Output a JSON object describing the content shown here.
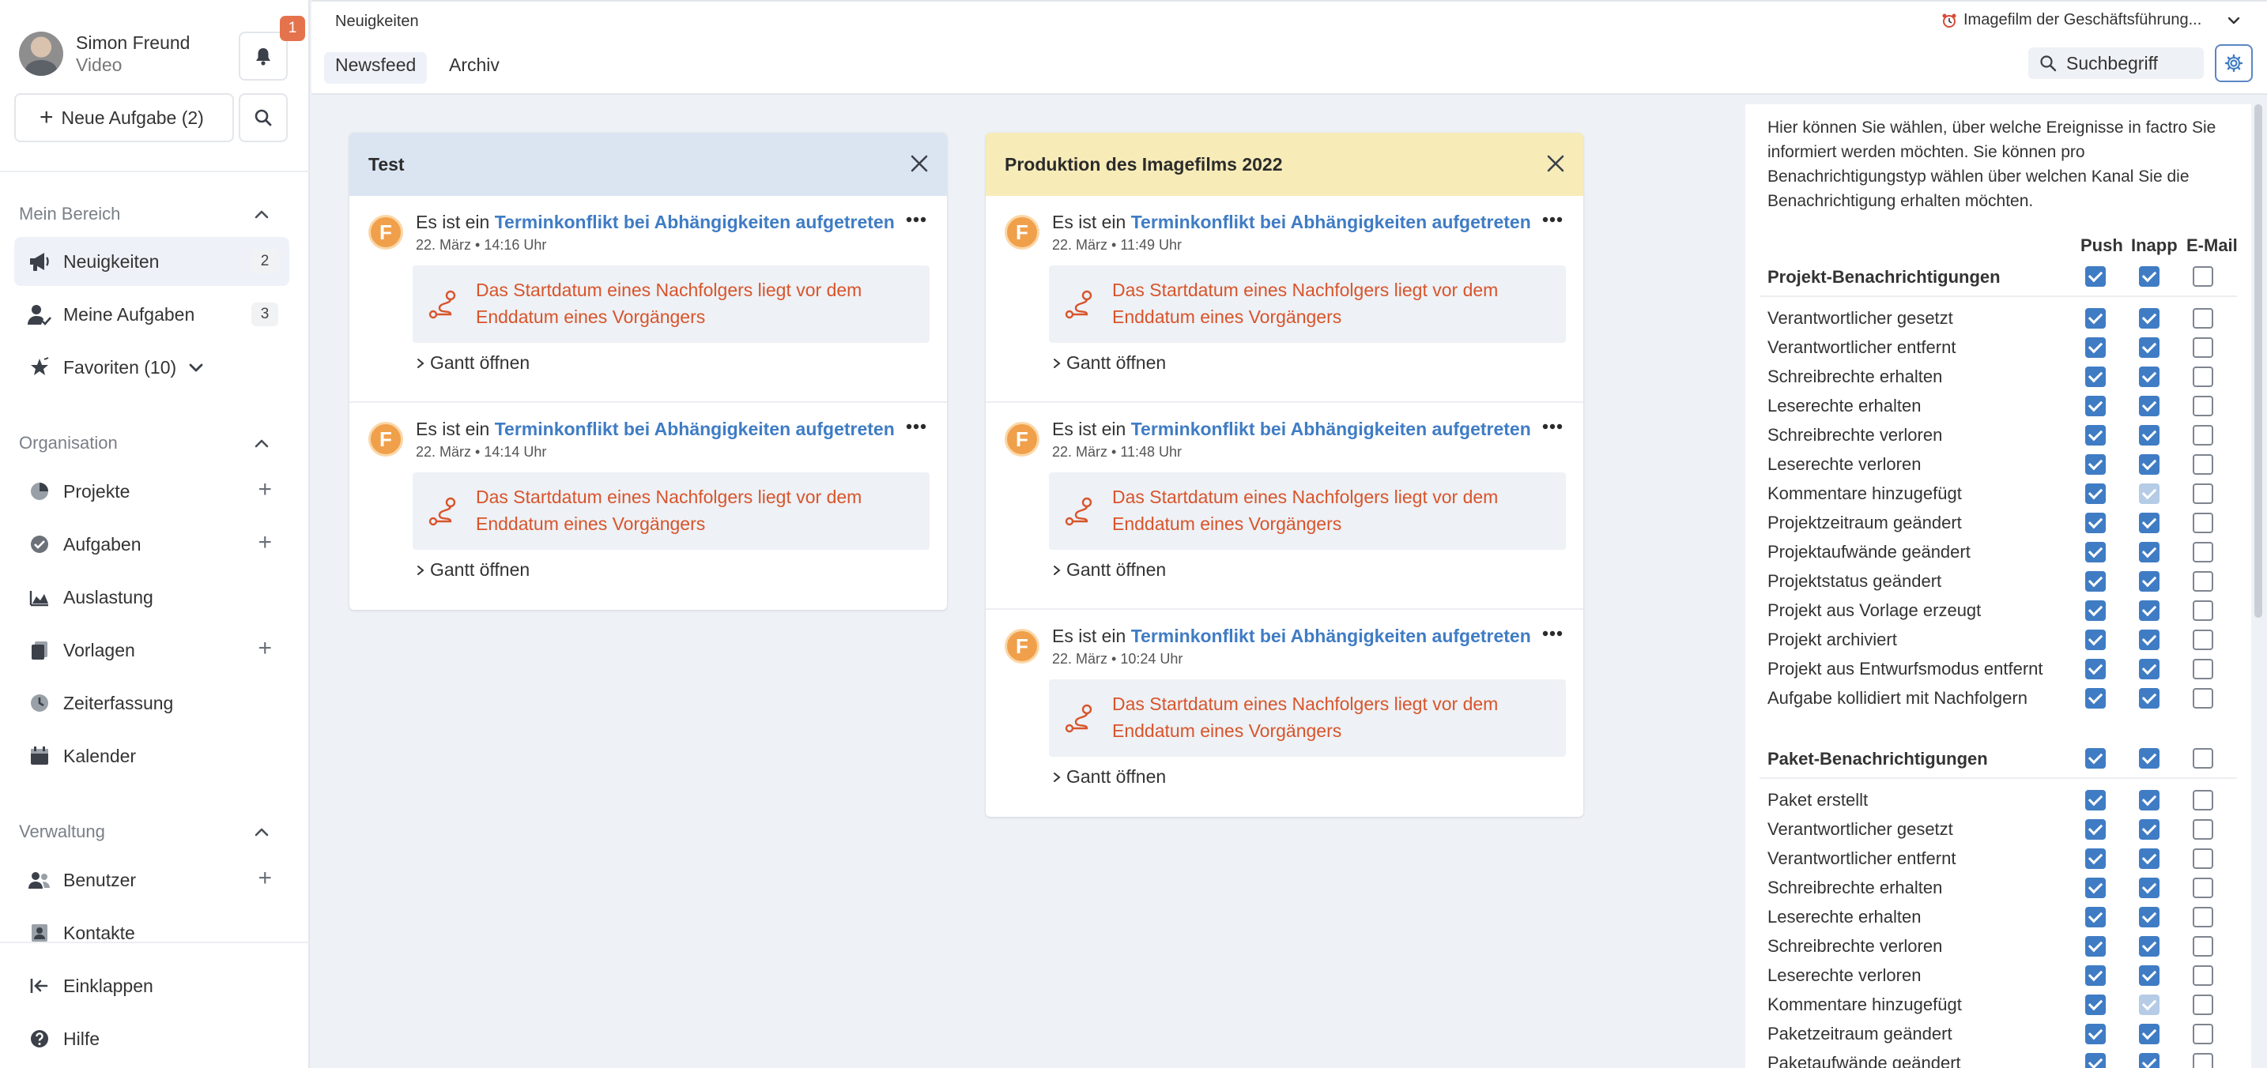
{
  "user": {
    "name": "Simon Freund",
    "subtitle": "Video",
    "notifications": "1"
  },
  "sidebar": {
    "new_task_label": "Neue Aufgabe (2)",
    "sections": {
      "mein_bereich": "Mein Bereich",
      "organisation": "Organisation",
      "verwaltung": "Verwaltung"
    },
    "items": {
      "neuigkeiten": {
        "label": "Neuigkeiten",
        "count": "2"
      },
      "meine_aufgaben": {
        "label": "Meine Aufgaben",
        "count": "3"
      },
      "favoriten": {
        "label": "Favoriten (10)"
      },
      "projekte": {
        "label": "Projekte"
      },
      "aufgaben": {
        "label": "Aufgaben"
      },
      "auslastung": {
        "label": "Auslastung"
      },
      "vorlagen": {
        "label": "Vorlagen"
      },
      "zeiterfassung": {
        "label": "Zeiterfassung"
      },
      "kalender": {
        "label": "Kalender"
      },
      "benutzer": {
        "label": "Benutzer"
      },
      "kontakte": {
        "label": "Kontakte"
      },
      "einklappen": {
        "label": "Einklappen"
      },
      "hilfe": {
        "label": "Hilfe"
      }
    }
  },
  "header": {
    "breadcrumb": "Neuigkeiten",
    "tabs": [
      "Newsfeed",
      "Archiv"
    ],
    "project_select": "Imagefilm der Geschäftsführung...",
    "search_placeholder": "Suchbegriff"
  },
  "feed": {
    "entry_prefix": "Es ist ein",
    "entry_link": "Terminkonflikt bei Abhängigkeiten aufgetreten",
    "entry_message": "Das Startdatum eines Nachfolgers liegt vor dem Enddatum eines Vorgängers",
    "gantt_label": "Gantt öffnen",
    "columns": [
      {
        "title": "Test",
        "header_color": "#dbe5f2",
        "times": [
          "22. März • 14:16 Uhr",
          "22. März • 14:14 Uhr"
        ]
      },
      {
        "title": "Produktion des Imagefilms 2022",
        "header_color": "#f7ebb8",
        "times": [
          "22. März • 11:49 Uhr",
          "22. März • 11:48 Uhr",
          "22. März • 10:24 Uhr"
        ]
      }
    ]
  },
  "settings": {
    "intro": "Hier können Sie wählen, über welche Ereignisse in factro Sie informiert werden möchten. Sie können pro Benachrichtigungstyp wählen über welchen Kanal Sie die Benachrichtigung erhalten möchten.",
    "channels": [
      "Push",
      "Inapp",
      "E-Mail"
    ],
    "groups": [
      {
        "title": "Projekt-Benachrichtigungen",
        "header_state": [
          "on",
          "on",
          "off"
        ],
        "rows": [
          {
            "label": "Verantwortlicher gesetzt",
            "state": [
              "on",
              "on",
              "off"
            ]
          },
          {
            "label": "Verantwortlicher entfernt",
            "state": [
              "on",
              "on",
              "off"
            ]
          },
          {
            "label": "Schreibrechte erhalten",
            "state": [
              "on",
              "on",
              "off"
            ]
          },
          {
            "label": "Leserechte erhalten",
            "state": [
              "on",
              "on",
              "off"
            ]
          },
          {
            "label": "Schreibrechte verloren",
            "state": [
              "on",
              "on",
              "off"
            ]
          },
          {
            "label": "Leserechte verloren",
            "state": [
              "on",
              "on",
              "off"
            ]
          },
          {
            "label": "Kommentare hinzugefügt",
            "state": [
              "on",
              "dim",
              "off"
            ]
          },
          {
            "label": "Projektzeitraum geändert",
            "state": [
              "on",
              "on",
              "off"
            ]
          },
          {
            "label": "Projektaufwände geändert",
            "state": [
              "on",
              "on",
              "off"
            ]
          },
          {
            "label": "Projektstatus geändert",
            "state": [
              "on",
              "on",
              "off"
            ]
          },
          {
            "label": "Projekt aus Vorlage erzeugt",
            "state": [
              "on",
              "on",
              "off"
            ]
          },
          {
            "label": "Projekt archiviert",
            "state": [
              "on",
              "on",
              "off"
            ]
          },
          {
            "label": "Projekt aus Entwurfsmodus entfernt",
            "state": [
              "on",
              "on",
              "off"
            ]
          },
          {
            "label": "Aufgabe kollidiert mit Nachfolgern",
            "state": [
              "on",
              "on",
              "off"
            ]
          }
        ]
      },
      {
        "title": "Paket-Benachrichtigungen",
        "header_state": [
          "on",
          "on",
          "off"
        ],
        "rows": [
          {
            "label": "Paket erstellt",
            "state": [
              "on",
              "on",
              "off"
            ]
          },
          {
            "label": "Verantwortlicher gesetzt",
            "state": [
              "on",
              "on",
              "off"
            ]
          },
          {
            "label": "Verantwortlicher entfernt",
            "state": [
              "on",
              "on",
              "off"
            ]
          },
          {
            "label": "Schreibrechte erhalten",
            "state": [
              "on",
              "on",
              "off"
            ]
          },
          {
            "label": "Leserechte erhalten",
            "state": [
              "on",
              "on",
              "off"
            ]
          },
          {
            "label": "Schreibrechte verloren",
            "state": [
              "on",
              "on",
              "off"
            ]
          },
          {
            "label": "Leserechte verloren",
            "state": [
              "on",
              "on",
              "off"
            ]
          },
          {
            "label": "Kommentare hinzugefügt",
            "state": [
              "on",
              "dim",
              "off"
            ]
          },
          {
            "label": "Paketzeitraum geändert",
            "state": [
              "on",
              "on",
              "off"
            ]
          },
          {
            "label": "Paketaufwände geändert",
            "state": [
              "on",
              "on",
              "off"
            ]
          }
        ]
      }
    ]
  },
  "colors": {
    "accent": "#3f7cc4",
    "warning": "#d8542b",
    "badge": "#e4734d",
    "factro_orange": "#f0a04b"
  }
}
